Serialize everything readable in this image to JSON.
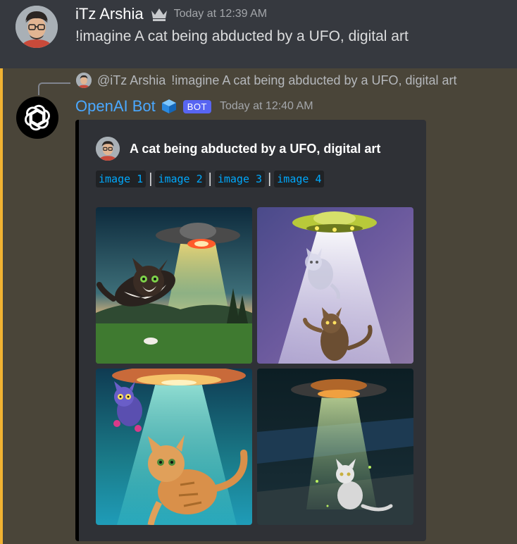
{
  "message1": {
    "author": "iTz Arshia",
    "timestamp": "Today at 12:39 AM",
    "content": "!imagine A cat being abducted by a UFO, digital art"
  },
  "message2": {
    "reply": {
      "mention": "@iTz Arshia",
      "text": "!imagine A cat being abducted by a UFO, digital art"
    },
    "author": "OpenAI Bot",
    "badge": "BOT",
    "timestamp": "Today at 12:40 AM",
    "embed": {
      "title": "A cat being abducted by a UFO, digital art",
      "links": [
        "image 1",
        "image 2",
        "image 3",
        "image 4"
      ],
      "images": [
        {
          "icon": "cat-ufo-image-1"
        },
        {
          "icon": "cat-ufo-image-2"
        },
        {
          "icon": "cat-ufo-image-3"
        },
        {
          "icon": "cat-ufo-image-4"
        }
      ]
    }
  },
  "colors": {
    "background": "#36393f",
    "mention_highlight": "#4a4539",
    "mention_bar": "#f0b232",
    "embed_bg": "#2f3136",
    "link": "#00a8fc",
    "bot_name": "#4aa8ff",
    "bot_badge": "#5865f2"
  }
}
